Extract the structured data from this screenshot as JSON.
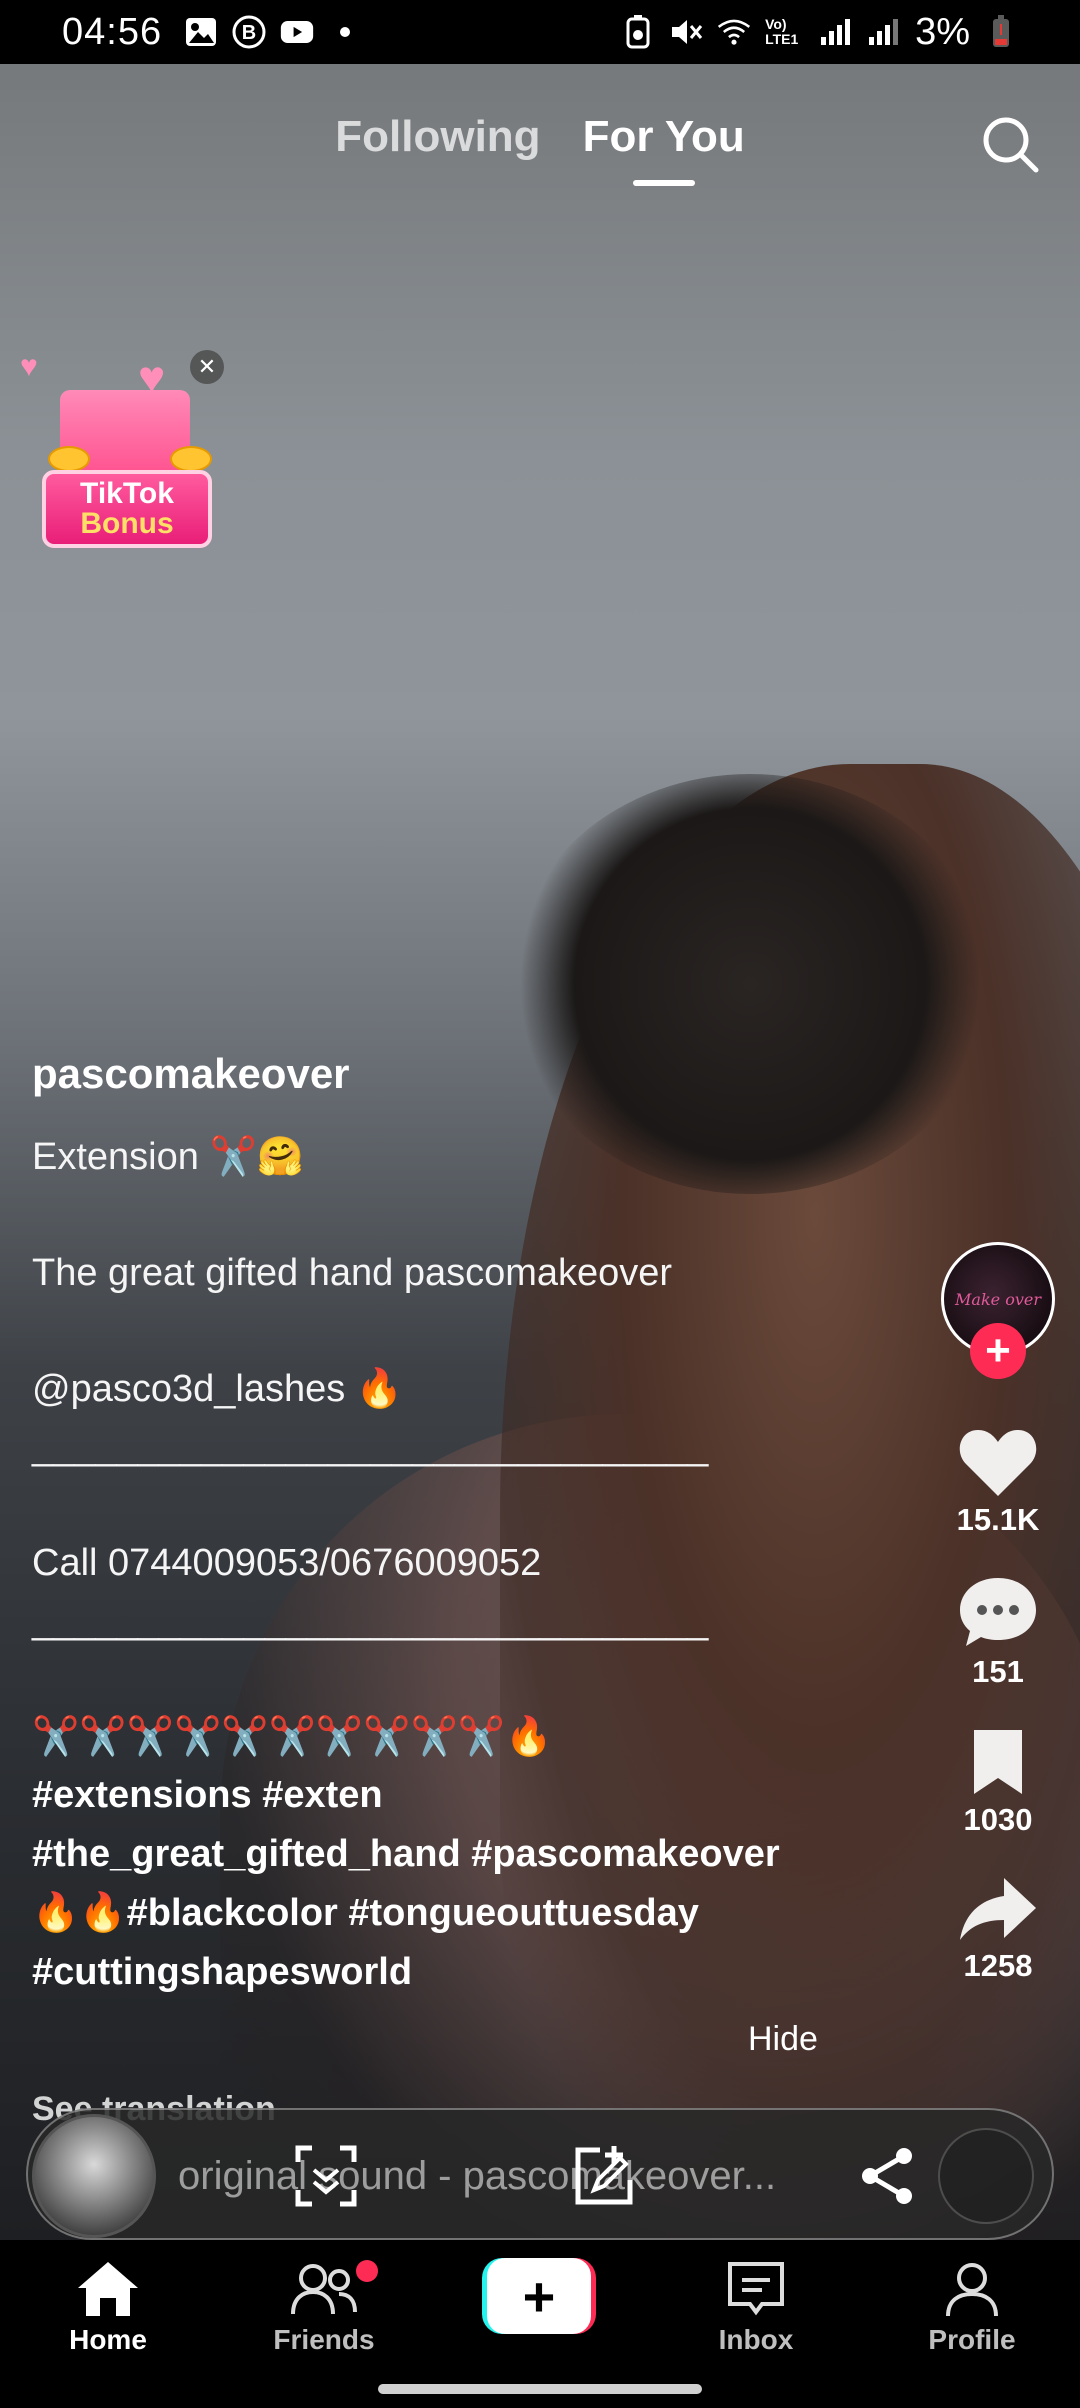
{
  "status_bar": {
    "time": "04:56",
    "battery": "3%",
    "network_label": "Vo) LTE1"
  },
  "top_tabs": {
    "following": "Following",
    "for_you": "For You"
  },
  "bonus": {
    "line1": "TikTok",
    "line2": "Bonus"
  },
  "post": {
    "username": "pascomakeover",
    "description": "Extension ✂️🤗\n\nThe great gifted hand pascomakeover\n\n@pasco3d_lashes 🔥\n________________________________\n\nCall 0744009053/0676009052\n________________________________\n\n✂️✂️✂️✂️✂️✂️✂️✂️✂️✂️🔥",
    "hashtags": "#extensions #exten\n#the_great_gifted_hand #pascomakeover\n🔥🔥#blackcolor #tongueouttuesday\n#cuttingshapesworld",
    "hide_label": "Hide",
    "see_translation": "See translation",
    "sound": "original sound - pascomakeover..."
  },
  "rail": {
    "avatar_text": "Make over",
    "likes": "15.1K",
    "comments": "151",
    "saves": "1030",
    "shares": "1258"
  },
  "nav": {
    "home": "Home",
    "friends": "Friends",
    "inbox": "Inbox",
    "profile": "Profile"
  },
  "colors": {
    "accent": "#fe2c55",
    "cyan": "#25f4ee"
  }
}
